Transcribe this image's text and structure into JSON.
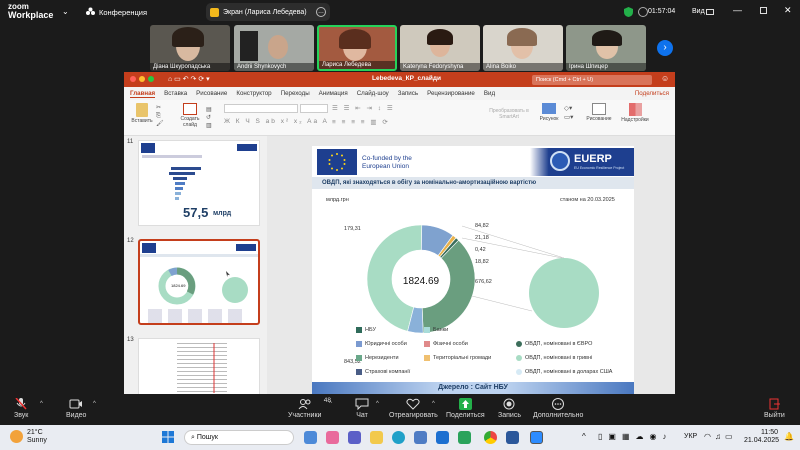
{
  "topbar": {
    "logo_line1": "zoom",
    "logo_line2": "Workplace",
    "meeting_label": "Конференция",
    "share_label": "Экран (Лариса Лебедева)",
    "timer": "01:57:04",
    "view_label": "Вид"
  },
  "participants": [
    {
      "name": "Діана Шкуропадська"
    },
    {
      "name": "Andrii Shynkovych"
    },
    {
      "name": "Лариса Лебедева"
    },
    {
      "name": "Kateryna Fedoryshyna"
    },
    {
      "name": "Alina Boiko"
    },
    {
      "name": "Ірина Шпицер"
    }
  ],
  "ppt": {
    "file_title": "Lebedeva_КР_слайди",
    "search_placeholder": "Поиск (Cmd + Ctrl + U)",
    "tabs": [
      "Главная",
      "Вставка",
      "Рисование",
      "Конструктор",
      "Переходы",
      "Анимация",
      "Слайд-шоу",
      "Запись",
      "Рецензирование",
      "Вид"
    ],
    "share_button": "Поделиться",
    "ribbon": {
      "paste": "Вставить",
      "new_slide": "Создать слайд",
      "smartart": "Преобразовать в SmartArt",
      "picture": "Рисунок",
      "drawing": "Рисование",
      "addins": "Надстройки"
    },
    "thumbs": [
      {
        "num": "11",
        "big_value": "57,5",
        "unit": "млрд"
      },
      {
        "num": "12",
        "center": "1824.69"
      },
      {
        "num": "13"
      }
    ]
  },
  "slide": {
    "cofunded_line1": "Co-funded by the",
    "cofunded_line2": "European Union",
    "euerp": "EUERP",
    "euerp_sub": "EU Economic Resilience Project",
    "title": "ОВДП, які знаходяться в обігу за номінально-амортизаційною вартістю",
    "unit": "млрд.грн",
    "date": "станом на 20.03.2025",
    "center_value": "1824.69",
    "source": "Джерело : Сайт НБУ"
  },
  "chart_data": {
    "type": "pie",
    "style": "donut",
    "center_label": "1824.69",
    "slices": [
      {
        "label": "ОВДП, номіновані в гривні",
        "value": 843.52,
        "color": "#a8dcc4"
      },
      {
        "label": "Банки",
        "value": 179.31,
        "color": "#7fa2cf"
      },
      {
        "label": "Страхові компанії",
        "value": 21.18,
        "color": "#e9b24a"
      },
      {
        "label": "Нерезиденти",
        "value": 0.42,
        "color": "#6a9e8c"
      },
      {
        "label": "Юридичні особи",
        "value": 18.82,
        "color": "#3c6e5b"
      },
      {
        "label": "НБУ",
        "value": 676.62,
        "color": "#6a9e7f"
      },
      {
        "label": "ОВДП, номіновані в ЄВРО",
        "value": 84.82,
        "color": "#8ab1d9"
      }
    ],
    "data_labels": [
      "179,31",
      "84,82",
      "21,18",
      "0,42",
      "18,82",
      "676,62",
      "843,52"
    ],
    "legend": [
      {
        "label": "НБУ",
        "color": "#2f6b5a",
        "shape": "square"
      },
      {
        "label": "Банки",
        "color": "#a8dcd9",
        "shape": "square"
      },
      {
        "label": "Юридичні особи",
        "color": "#7b9ad0",
        "shape": "square"
      },
      {
        "label": "Фізичні особи",
        "color": "#e08a8a",
        "shape": "square"
      },
      {
        "label": "ОВДП, номіновані в ЄВРО",
        "color": "#3c6e5b",
        "shape": "circle"
      },
      {
        "label": "Нерезиденти",
        "color": "#6aa88a",
        "shape": "square"
      },
      {
        "label": "Територіальні громади",
        "color": "#f0c070",
        "shape": "square"
      },
      {
        "label": "ОВДП, номіновані в гривні",
        "color": "#a8dcc4",
        "shape": "circle"
      },
      {
        "label": "Страхові компанії",
        "color": "#4a5d86",
        "shape": "square"
      },
      {
        "label": "ОВДП, номіновані в доларах США",
        "color": "#d6eaf5",
        "shape": "circle"
      }
    ]
  },
  "toolbar": {
    "audio": "Звук",
    "video": "Видео",
    "participants_count": "48",
    "participants": "Участники",
    "chat": "Чат",
    "react": "Отреагировать",
    "share": "Поделиться",
    "record": "Запись",
    "more": "Дополнительно",
    "leave": "Выйти"
  },
  "taskbar": {
    "temp": "21°C",
    "weather": "Sunny",
    "search": "Пошук",
    "lang": "УКР",
    "time": "11:50",
    "date": "21.04.2025"
  }
}
